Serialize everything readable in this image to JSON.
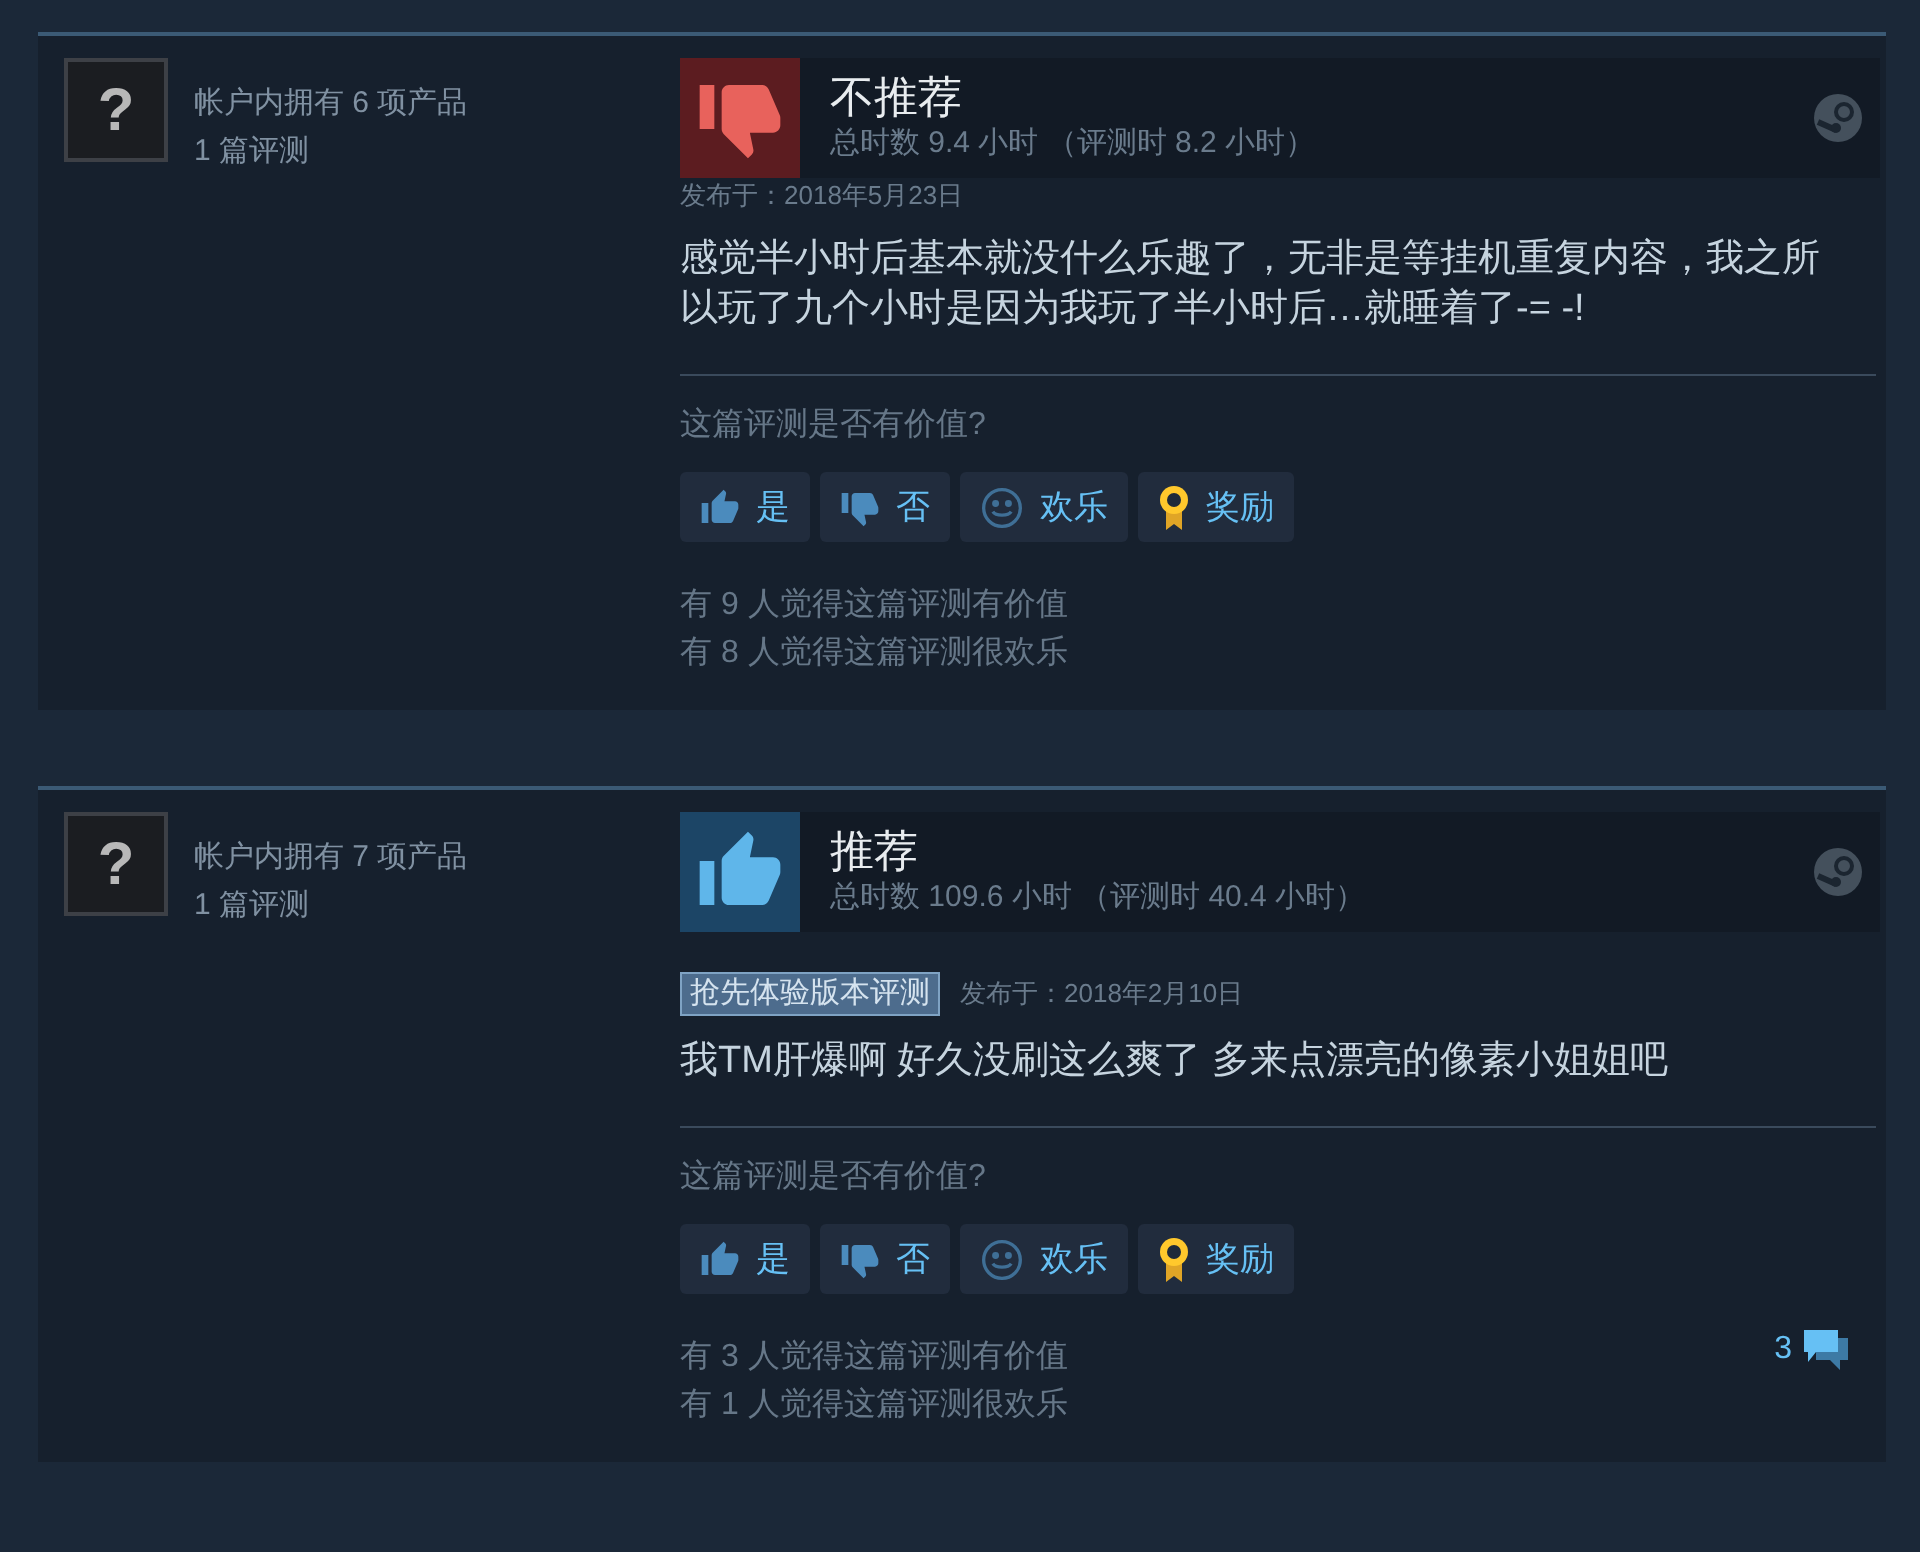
{
  "reviews": [
    {
      "author": {
        "avatar": "?",
        "products": "帐户内拥有 6 项产品",
        "reviews": "1 篇评测"
      },
      "recommended": false,
      "verdict": "不推荐",
      "hours": "总时数 9.4 小时 （评测时 8.2 小时）",
      "date": "发布于：2018年5月23日",
      "text": "感觉半小时后基本就没什么乐趣了，无非是等挂机重复内容，我之所以玩了九个小时是因为我玩了半小时后…就睡着了-= -!",
      "question": "这篇评测是否有价值?",
      "buttons": [
        {
          "kind": "yes",
          "label": "是"
        },
        {
          "kind": "no",
          "label": "否"
        },
        {
          "kind": "funny",
          "label": "欢乐"
        },
        {
          "kind": "award",
          "label": "奖励"
        }
      ],
      "stats": [
        "有 9 人觉得这篇评测有价值",
        "有 8 人觉得这篇评测很欢乐"
      ]
    },
    {
      "author": {
        "avatar": "?",
        "products": "帐户内拥有 7 项产品",
        "reviews": "1 篇评测"
      },
      "recommended": true,
      "verdict": "推荐",
      "hours": "总时数 109.6 小时 （评测时 40.4 小时）",
      "tag": "抢先体验版本评测",
      "date": "发布于：2018年2月10日",
      "text": "我TM肝爆啊 好久没刷这么爽了 多来点漂亮的像素小姐姐吧",
      "question": "这篇评测是否有价值?",
      "buttons": [
        {
          "kind": "yes",
          "label": "是"
        },
        {
          "kind": "no",
          "label": "否"
        },
        {
          "kind": "funny",
          "label": "欢乐"
        },
        {
          "kind": "award",
          "label": "奖励"
        }
      ],
      "stats": [
        "有 3 人觉得这篇评测有价值",
        "有 1 人觉得这篇评测很欢乐"
      ],
      "comments": "3"
    }
  ]
}
